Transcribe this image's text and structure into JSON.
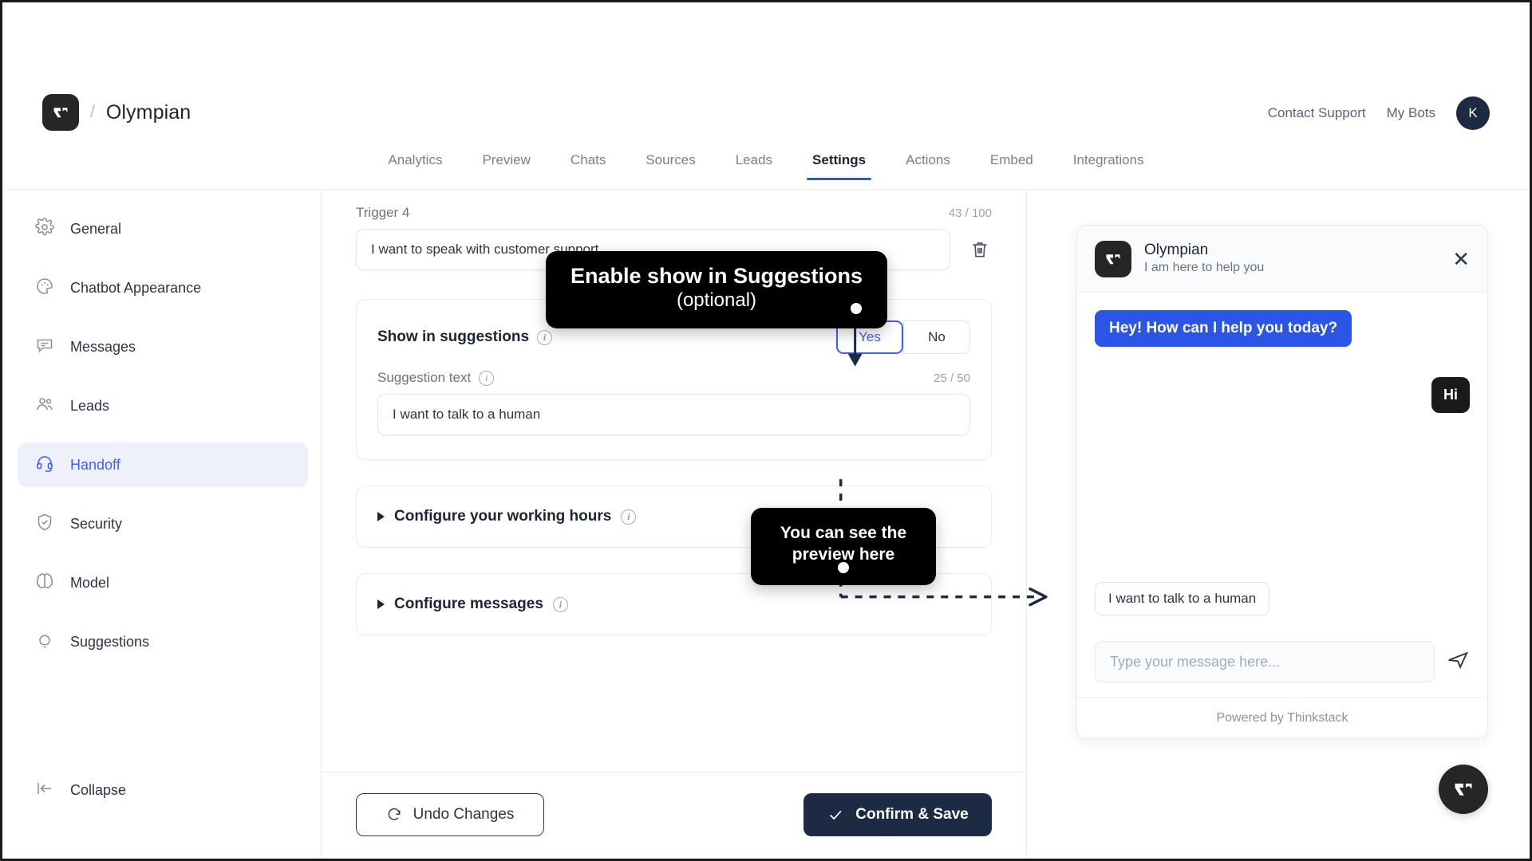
{
  "header": {
    "logo_icon": "thinkstack-logo-icon",
    "separator": "/",
    "bot_name": "Olympian",
    "contact_support": "Contact Support",
    "my_bots": "My Bots",
    "avatar_initial": "K"
  },
  "tabs": [
    {
      "label": "Analytics",
      "active": false
    },
    {
      "label": "Preview",
      "active": false
    },
    {
      "label": "Chats",
      "active": false
    },
    {
      "label": "Sources",
      "active": false
    },
    {
      "label": "Leads",
      "active": false
    },
    {
      "label": "Settings",
      "active": true
    },
    {
      "label": "Actions",
      "active": false
    },
    {
      "label": "Embed",
      "active": false
    },
    {
      "label": "Integrations",
      "active": false
    }
  ],
  "sidebar": {
    "items": [
      {
        "label": "General",
        "icon": "gear-icon",
        "active": false
      },
      {
        "label": "Chatbot Appearance",
        "icon": "palette-icon",
        "active": false
      },
      {
        "label": "Messages",
        "icon": "chat-bubble-icon",
        "active": false
      },
      {
        "label": "Leads",
        "icon": "users-icon",
        "active": false
      },
      {
        "label": "Handoff",
        "icon": "headset-icon",
        "active": true
      },
      {
        "label": "Security",
        "icon": "shield-check-icon",
        "active": false
      },
      {
        "label": "Model",
        "icon": "brain-icon",
        "active": false
      },
      {
        "label": "Suggestions",
        "icon": "lightbulb-icon",
        "active": false
      }
    ],
    "collapse": {
      "label": "Collapse",
      "icon": "collapse-left-icon"
    }
  },
  "main": {
    "trigger": {
      "label": "Trigger 4",
      "counter": "43 / 100",
      "value": "I want to speak with customer support",
      "delete_icon": "trash-icon"
    },
    "suggestions_card": {
      "title": "Show in suggestions",
      "info_icon": "info-icon",
      "toggle": {
        "yes": "Yes",
        "no": "No",
        "selected": "Yes"
      },
      "sub_label": "Suggestion text",
      "sub_counter": "25 / 50",
      "suggestion_value": "I want to talk to a human"
    },
    "accordions": [
      {
        "label": "Configure your working hours",
        "icon": "caret-right-icon",
        "info_icon": "info-icon"
      },
      {
        "label": "Configure messages",
        "icon": "caret-right-icon",
        "info_icon": "info-icon"
      }
    ],
    "footer": {
      "undo_label": "Undo Changes",
      "undo_icon": "refresh-icon",
      "save_label": "Confirm & Save",
      "save_icon": "check-icon"
    }
  },
  "chat_preview": {
    "logo_icon": "thinkstack-logo-icon",
    "title": "Olympian",
    "subtitle": "I am here to help you",
    "close_icon": "close-icon",
    "bot_message": "Hey! How can I help you today?",
    "user_message": "Hi",
    "suggestion_chip": "I want to talk to a human",
    "input_placeholder": "Type your message here...",
    "send_icon": "send-icon",
    "footer": "Powered by Thinkstack",
    "fab_icon": "thinkstack-logo-icon"
  },
  "annotations": {
    "tip1_line1": "Enable show in Suggestions",
    "tip1_line2": "(optional)",
    "tip2_line1": "You can see the",
    "tip2_line2": "preview here"
  },
  "colors": {
    "accent_blue": "#3d63ee",
    "bubble_blue": "#2b55e6",
    "dark": "#1d2a43",
    "black": "#000000"
  }
}
